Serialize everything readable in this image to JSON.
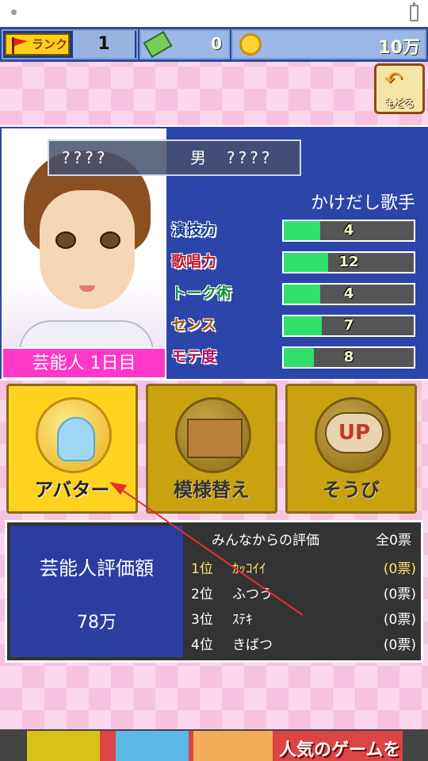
{
  "header": {
    "rank_label": "ランク",
    "rank": "1",
    "tickets": "0",
    "money": "10万"
  },
  "back_button": {
    "label": "もどる"
  },
  "profile": {
    "name": "????",
    "gender": "男",
    "name2": "????",
    "job": "かけだし歌手",
    "day_label": "芸能人 1日目"
  },
  "stats": [
    {
      "name": "演技力",
      "value": "4",
      "fill": 0.28,
      "color": "#123a8f"
    },
    {
      "name": "歌唱力",
      "value": "12",
      "fill": 0.34,
      "color": "#c0152a"
    },
    {
      "name": "トーク術",
      "value": "4",
      "fill": 0.28,
      "color": "#1a8a3a"
    },
    {
      "name": "センス",
      "value": "7",
      "fill": 0.29,
      "color": "#a0520a"
    },
    {
      "name": "モテ度",
      "value": "8",
      "fill": 0.23,
      "color": "#b0105a"
    }
  ],
  "menu": {
    "avatar": "アバター",
    "remodel": "模様替え",
    "equip": "そうび",
    "up_badge": "UP"
  },
  "evaluation": {
    "title": "芸能人評価額",
    "amount": "78万",
    "heading": "みんなからの評価",
    "total": "全0票",
    "rows": [
      {
        "pos": "1位",
        "name": "ｶｯｺｲｲ",
        "votes": "(0票)"
      },
      {
        "pos": "2位",
        "name": "ふつう",
        "votes": "(0票)"
      },
      {
        "pos": "3位",
        "name": "ｽﾃｷ",
        "votes": "(0票)"
      },
      {
        "pos": "4位",
        "name": "きばつ",
        "votes": "(0票)"
      }
    ]
  },
  "ad": {
    "text": "人気のゲームを"
  }
}
